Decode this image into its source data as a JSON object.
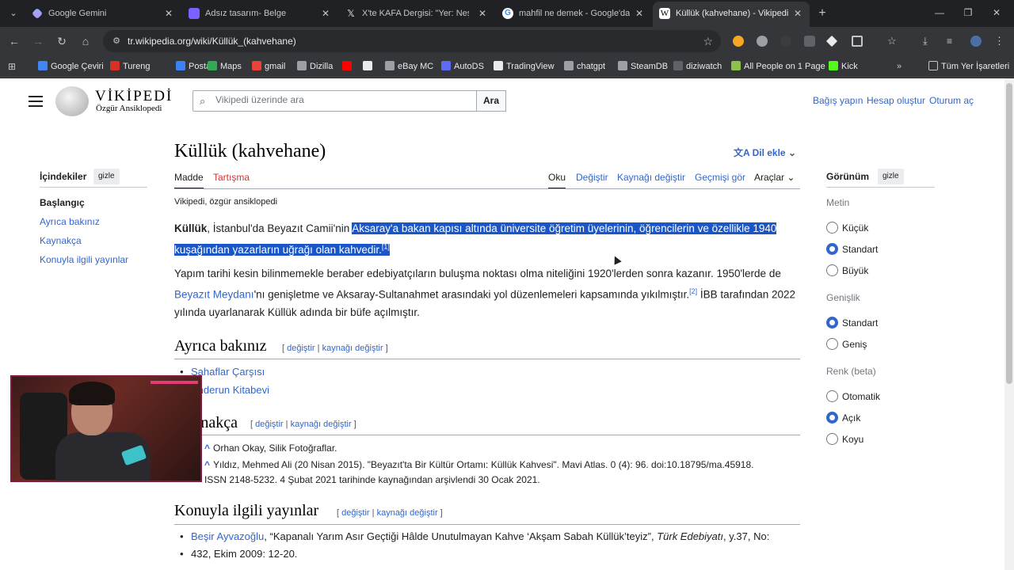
{
  "browser": {
    "tabs": [
      {
        "title": "Google Gemini",
        "favicon_color": "#8ab4f8"
      },
      {
        "title": "Adsız tasarım- Belge",
        "favicon_color": "#7b61ff"
      },
      {
        "title": "X'te KAFA Dergisi: \"Yer: Neşe Re",
        "favicon_color": "#000000"
      },
      {
        "title": "mahfil ne demek - Google'da A",
        "favicon_color": "#4285f4"
      },
      {
        "title": "Küllük (kahvehane) - Vikipedi",
        "favicon_color": "#ffffff"
      }
    ],
    "active_tab": 4,
    "url": "tr.wikipedia.org/wiki/Küllük_(kahvehane)",
    "bookmarks": [
      {
        "label": "Google Çeviri",
        "color": "#4285f4"
      },
      {
        "label": "Tureng",
        "color": "#d93025"
      },
      {
        "label": "Posta",
        "color": "#3b82f6"
      },
      {
        "label": "Maps",
        "color": "#34a853"
      },
      {
        "label": "gmail",
        "color": "#ea4335"
      },
      {
        "label": "Dizilla",
        "color": "#9aa0a6"
      },
      {
        "label": "",
        "color": "#ff0000"
      },
      {
        "label": "",
        "color": "#e8eaed"
      },
      {
        "label": "eBay MC",
        "color": "#9aa0a6"
      },
      {
        "label": "AutoDS",
        "color": "#5f6bf5"
      },
      {
        "label": "TradingView",
        "color": "#e8eaed"
      },
      {
        "label": "chatgpt",
        "color": "#9aa0a6"
      },
      {
        "label": "SteamDB",
        "color": "#9aa0a6"
      },
      {
        "label": "diziwatch",
        "color": "#5f6368"
      },
      {
        "label": "All People on 1 Page",
        "color": "#8bc34a"
      },
      {
        "label": "Kick",
        "color": "#53fc18"
      }
    ],
    "all_bookmarks": "Tüm Yer İşaretleri"
  },
  "wiki": {
    "logo_title": "VİKİPEDİ",
    "logo_subtitle": "Özgür Ansiklopedi",
    "search_placeholder": "Vikipedi üzerinde ara",
    "search_button": "Ara",
    "top_links": [
      "Bağış yapın",
      "Hesap oluştur",
      "Oturum aç"
    ],
    "toc": {
      "title": "İçindekiler",
      "hide": "gizle",
      "items": [
        "Başlangıç",
        "Ayrıca bakınız",
        "Kaynakça",
        "Konuyla ilgili yayınlar"
      ]
    },
    "title": "Küllük (kahvehane)",
    "add_language": "Dil ekle",
    "tabs_left": [
      "Madde",
      "Tartışma"
    ],
    "tabs_right": [
      "Oku",
      "Değiştir",
      "Kaynağı değiştir",
      "Geçmişi gör",
      "Araçlar"
    ],
    "from": "Vikipedi, özgür ansiklopedi",
    "intro": {
      "bold": "Küllük",
      "pre": ", İstanbul'da Beyazıt Camii'nin ",
      "highlight": "Aksaray'a bakan kapısı altında üniversite öğretim üyelerinin, öğrencilerin ve özellikle 1940 kuşağından yazarların uğrağı olan kahvedir.",
      "ref": "[1]"
    },
    "para2": {
      "pre": "Yapım tarihi kesin bilinmemekle beraber edebiyatçıların buluşma noktası olma niteliğini 1920'lerden sonra kazanır. 1950'lerde de ",
      "link": "Beyazıt Meydanı",
      "mid": "'nı genişletme ve Aksaray-Sultanahmet arasındaki yol düzenlemeleri kapsamında yıkılmıştır.",
      "ref": "[2]",
      "post": " İBB tarafından 2022 yılında uyarlanarak Küllük adında bir büfe açılmıştır."
    },
    "sec_see_also": "Ayrıca bakınız",
    "edit_links": {
      "edit": "değiştir",
      "source": "kaynağı değiştir"
    },
    "see_also": [
      "Sahaflar Çarşısı",
      "Enderun Kitabevi"
    ],
    "sec_refs": "Kaynakça",
    "refs": [
      "Orhan Okay, Silik Fotoğraflar.",
      "Yıldız, Mehmed Ali (20 Nisan 2015). \"Beyazıt'ta Bir Kültür Ortamı: Küllük Kahvesi\". Mavi Atlas. 0 (4): 96. doi:10.18795/ma.45918.",
      "ISSN 2148-5232. 4 Şubat 2021 tarihinde kaynağından arşivlendi 30 Ocak 2021."
    ],
    "sec_pubs": "Konuyla ilgili yayınlar",
    "pub1_link": "Beşir Ayvazoğlu",
    "pub1_text": ", “Kapanalı Yarım Asır Geçtiği Hâlde Unutulmayan Kahve ‘Akşam Sabah Küllük’teyiz”, ",
    "pub1_journal": "Türk Edebiyatı",
    "pub1_tail": ", y.37, No:",
    "pub1_line2": "432, Ekim 2009: 12-20.",
    "appearance": {
      "title": "Görünüm",
      "hide": "gizle",
      "text_label": "Metin",
      "text_opts": [
        "Küçük",
        "Standart",
        "Büyük"
      ],
      "text_sel": 1,
      "width_label": "Genişlik",
      "width_opts": [
        "Standart",
        "Geniş"
      ],
      "width_sel": 0,
      "color_label": "Renk (beta)",
      "color_opts": [
        "Otomatik",
        "Açık",
        "Koyu"
      ],
      "color_sel": 1
    }
  }
}
